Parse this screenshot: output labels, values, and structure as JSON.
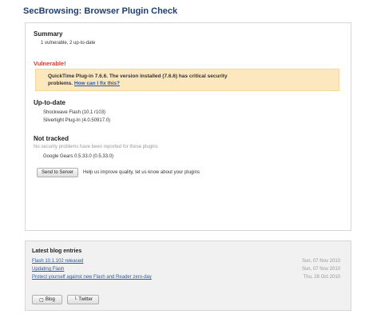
{
  "page": {
    "title": "SecBrowsing: Browser Plugin Check"
  },
  "summary": {
    "heading": "Summary",
    "text": "1 vulnerable, 2 up-to-date"
  },
  "vulnerable": {
    "heading": "Vulnerable!",
    "message": "QuickTime Plug-in 7.6.6. The version installed (7.6.6) has critical security",
    "message_cont": "problems.",
    "fix_link": "How can I fix this?"
  },
  "uptodate": {
    "heading": "Up-to-date",
    "items": [
      "Shockwave Flash (10.1 r103)",
      "Silverlight Plug-In (4.0.50917.0)"
    ]
  },
  "not_tracked": {
    "heading": "Not tracked",
    "note": "No security problems have been reported for these plugins",
    "items": [
      "Google Gears 0.5.33.0 (0.5.33.0)"
    ]
  },
  "send": {
    "button_label": "Send to Server",
    "hint": "Help us improve quality, let us know about your plugins"
  },
  "blog": {
    "heading": "Latest blog entries",
    "entries": [
      {
        "title": "Flash 10.1.102 released",
        "date": "Sun, 07 Nov 2010"
      },
      {
        "title": "Updating Flash",
        "date": "Sun, 07 Nov 2010"
      },
      {
        "title": "Protect yourself against new Flash and Reader zero-day",
        "date": "Thu, 28 Oct 2010"
      }
    ],
    "buttons": {
      "blog_label": "Blog",
      "twitter_label": "Twitter"
    }
  },
  "colors": {
    "accent": "#1f3f6e",
    "vulnerable": "#d13a2b",
    "warning_bg": "#fce7bf",
    "link": "#2b57a3"
  }
}
